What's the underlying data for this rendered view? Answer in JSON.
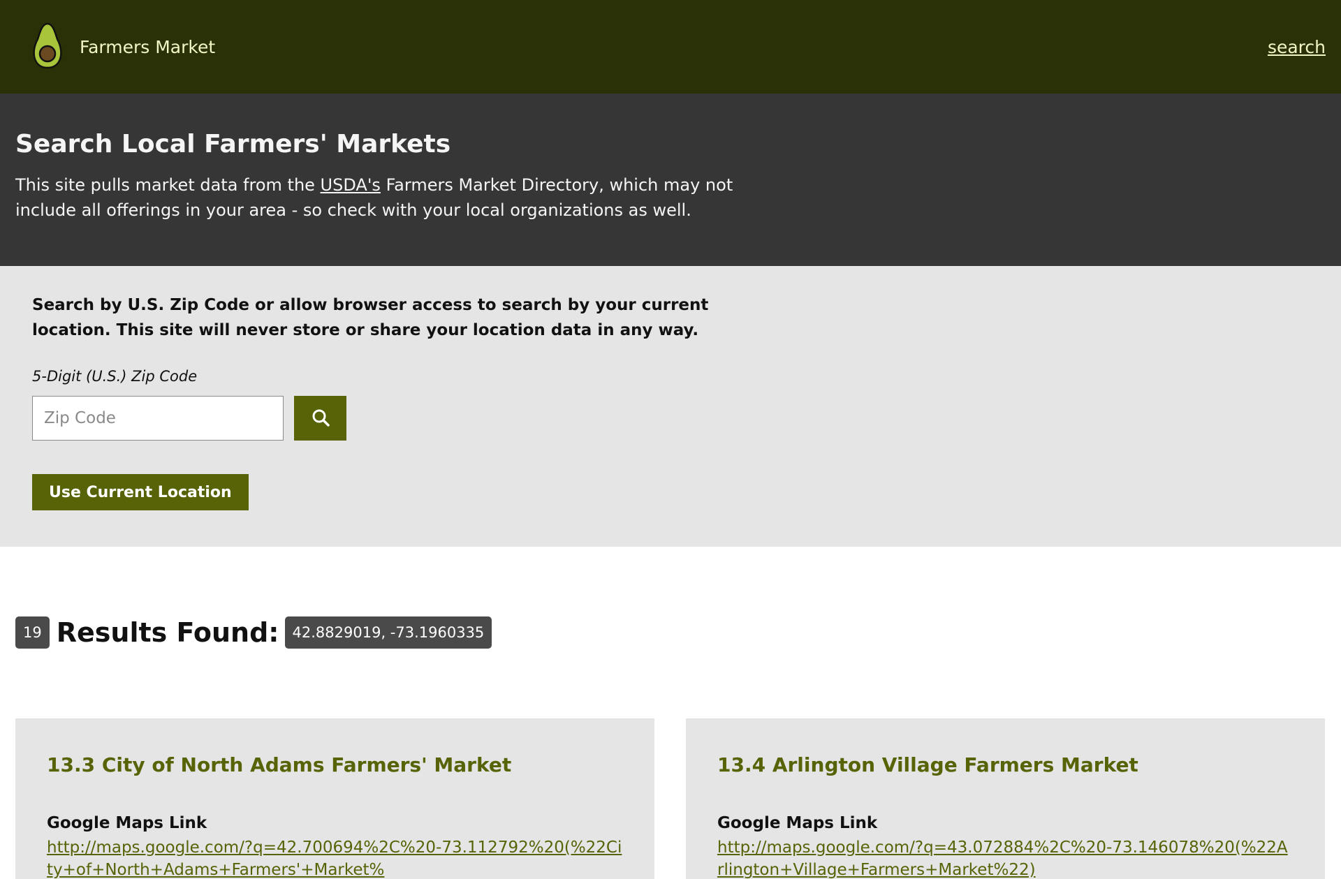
{
  "header": {
    "brand": "Farmers Market",
    "search_link": "search",
    "colors": {
      "background": "#2b3107",
      "text": "#f2f5c4",
      "logo": "#a7c43a"
    },
    "logo_icon": "avocado-icon"
  },
  "intro": {
    "title": "Search Local Farmers' Markets",
    "text_before": "This site pulls market data from the ",
    "usda_link": "USDA's",
    "text_after": " Farmers Market Directory, which may not include all offerings in your area - so check with your local organizations as well."
  },
  "search": {
    "description": "Search by U.S. Zip Code or allow browser access to search by your current location. This site will never store or share your location data in any way.",
    "zip_label": "5-Digit (U.S.) Zip Code",
    "zip_placeholder": "Zip Code",
    "zip_value": "",
    "search_icon": "search-icon",
    "location_button": "Use Current Location",
    "accent": "#576306"
  },
  "results": {
    "count": "19",
    "title": "Results Found:",
    "coords": "42.8829019, -73.1960335",
    "cards": [
      {
        "title": "13.3 City of North Adams Farmers' Market",
        "link_label": "Google Maps Link",
        "link": "http://maps.google.com/?q=42.700694%2C%20-73.112792%20(%22City+of+North+Adams+Farmers'+Market%"
      },
      {
        "title": "13.4 Arlington Village Farmers Market",
        "link_label": "Google Maps Link",
        "link": "http://maps.google.com/?q=43.072884%2C%20-73.146078%20(%22Arlington+Village+Farmers+Market%22)"
      }
    ]
  }
}
